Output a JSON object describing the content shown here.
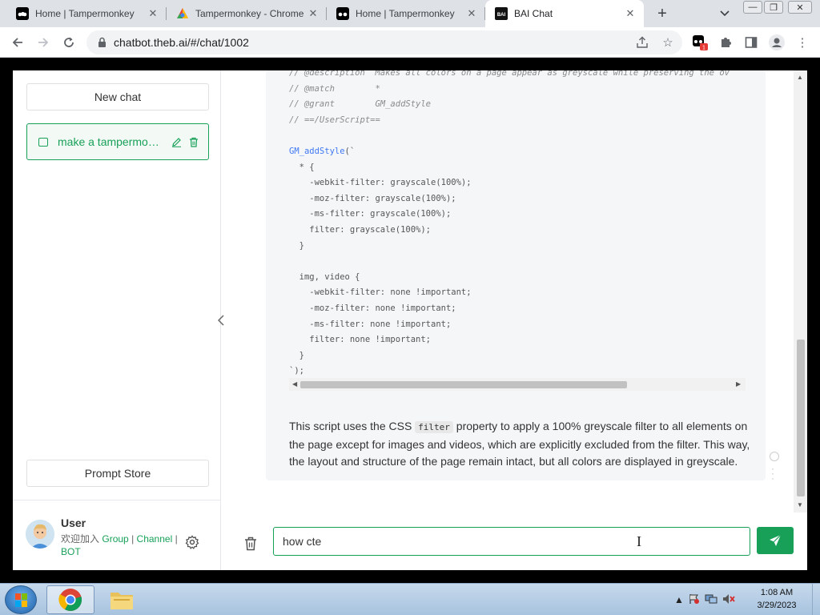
{
  "browser": {
    "tabs": [
      {
        "title": "Home | Tampermonkey",
        "favicon": "tampermonkey-icon",
        "active": false
      },
      {
        "title": "Tampermonkey - Chrome",
        "favicon": "chrome-webstore-icon",
        "active": false
      },
      {
        "title": "Home | Tampermonkey",
        "favicon": "tampermonkey-icon",
        "active": false
      },
      {
        "title": "BAI Chat",
        "favicon": "bai-icon",
        "active": true
      }
    ],
    "url": "chatbot.theb.ai/#/chat/1002",
    "extension_badge": "1"
  },
  "sidebar": {
    "new_chat_label": "New chat",
    "chat_items": [
      {
        "title": "make a tampermonkey script"
      }
    ],
    "prompt_store_label": "Prompt Store",
    "user": {
      "name": "User",
      "join_text": "欢迎加入",
      "link_group": "Group",
      "link_channel": "Channel",
      "link_bot": "BOT",
      "sep": "|"
    }
  },
  "message": {
    "code_lines": [
      "// @description  Makes all colors on a page appear as greyscale while preserving the ov",
      "// @match        *",
      "// @grant        GM_addStyle",
      "// ==/UserScript==",
      "",
      "GM_addStyle(`",
      "  * {",
      "    -webkit-filter: grayscale(100%);",
      "    -moz-filter: grayscale(100%);",
      "    -ms-filter: grayscale(100%);",
      "    filter: grayscale(100%);",
      "  }",
      "",
      "  img, video {",
      "    -webkit-filter: none !important;",
      "    -moz-filter: none !important;",
      "    -ms-filter: none !important;",
      "    filter: none !important;",
      "  }",
      "`);"
    ],
    "text_before": "This script uses the CSS ",
    "code_inline": "filter",
    "text_after": " property to apply a 100% greyscale filter to all elements on the page except for images and videos, which are explicitly excluded from the filter. This way, the layout and structure of the page remain intact, but all colors are displayed in greyscale."
  },
  "input": {
    "value": "how cte"
  },
  "taskbar": {
    "time": "1:08 AM",
    "date": "3/29/2023"
  },
  "colors": {
    "accent": "#18a058",
    "code_comment": "#8a8a8a",
    "code_function": "#4078f2"
  }
}
